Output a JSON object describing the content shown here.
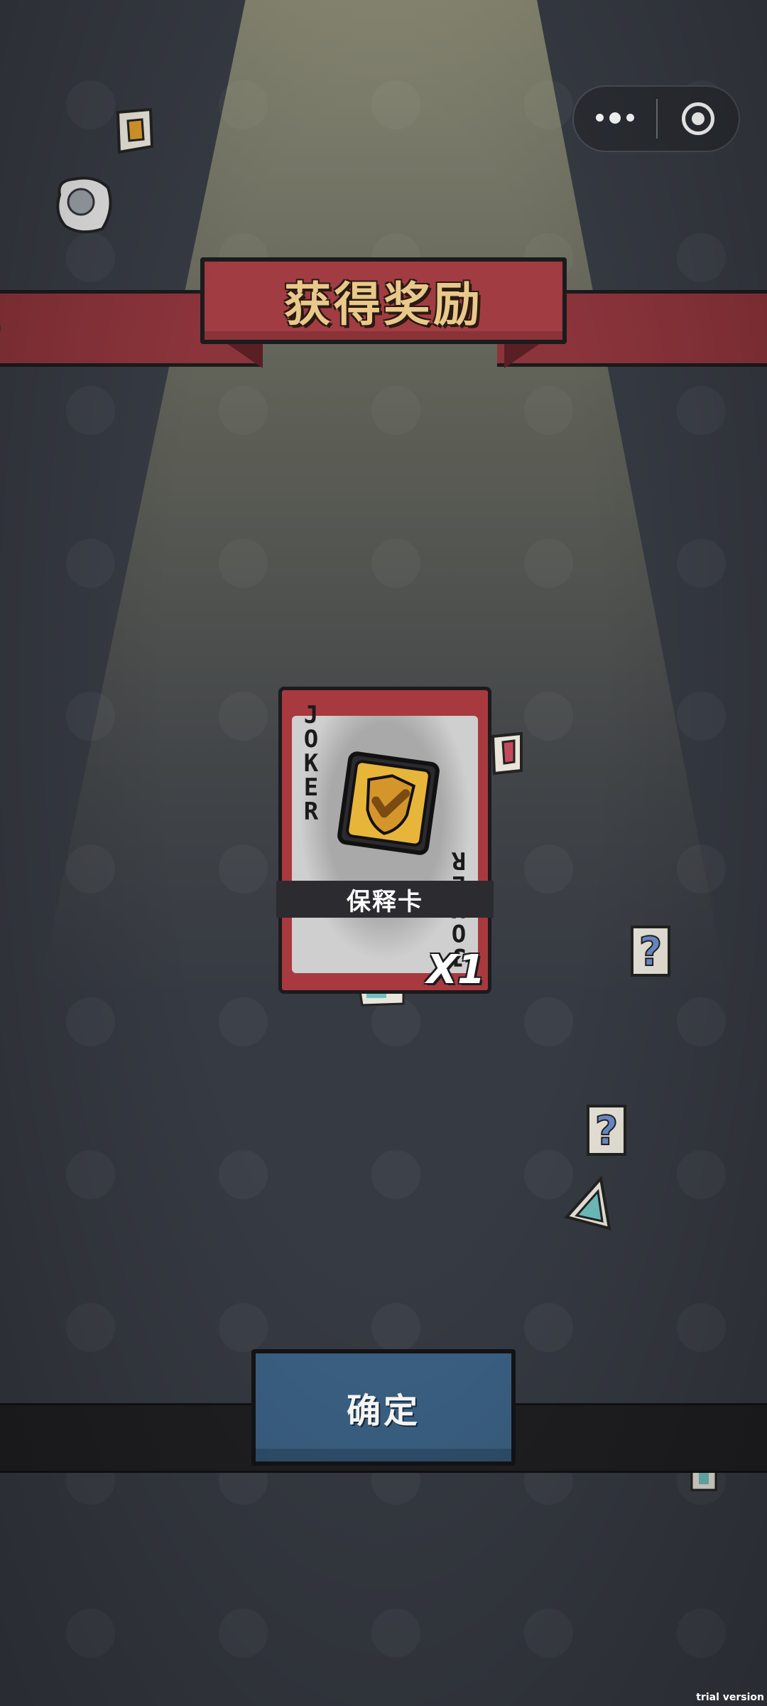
{
  "banner": {
    "title": "获得奖励"
  },
  "capsule": {
    "more_icon": "more-dots-icon",
    "close_icon": "target-close-icon"
  },
  "card": {
    "corner_text_top": "JOKER",
    "corner_text_bottom": "JOKER",
    "name": "保释卡",
    "quantity": "X1",
    "emblem_icon": "shield-check-icon"
  },
  "confirm": {
    "label": "确定"
  },
  "footer": {
    "watermark": "trial version"
  },
  "colors": {
    "background": "#363a42",
    "banner_red": "#a23c43",
    "card_red": "#a8393f",
    "button_blue": "#3b6184",
    "title_gold": "#e9c98a"
  }
}
